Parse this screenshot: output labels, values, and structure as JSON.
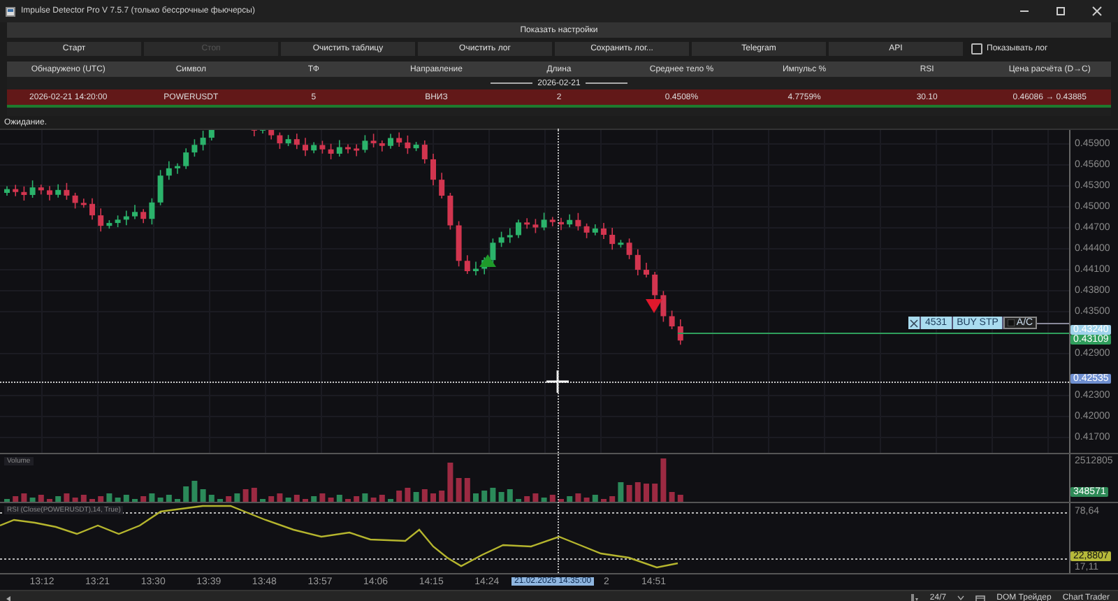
{
  "window": {
    "title": "Impulse Detector Pro V 7.5.7 (только бессрочные фьючерсы)"
  },
  "settings_button": "Показать настройки",
  "toolbar": {
    "buttons": [
      {
        "label": "Старт",
        "disabled": false
      },
      {
        "label": "Стоп",
        "disabled": true
      },
      {
        "label": "Очистить таблицу",
        "disabled": false
      },
      {
        "label": "Очистить лог",
        "disabled": false
      },
      {
        "label": "Сохранить лог...",
        "disabled": false
      },
      {
        "label": "Telegram",
        "disabled": false
      },
      {
        "label": "API",
        "disabled": false
      }
    ],
    "show_log": {
      "label": "Показывать лог",
      "checked": false
    }
  },
  "table": {
    "columns": [
      "Обнаружено (UTC)",
      "Символ",
      "ТФ",
      "Направление",
      "Длина",
      "Среднее тело %",
      "Импульс %",
      "RSI",
      "Цена расчёта (D→C)"
    ],
    "groups": [
      {
        "label": "2026-02-21",
        "rows": [
          {
            "cells": [
              "2026-02-21 14:20:00",
              "POWERUSDT",
              "5",
              "ВНИЗ",
              "2",
              "0.4508%",
              "4.7759%",
              "30.10",
              "0.46086 → 0.43885"
            ]
          }
        ]
      }
    ]
  },
  "status": "Ожидание.",
  "chart": {
    "price_axis": {
      "ticks": [
        "0.45900",
        "0.45600",
        "0.45300",
        "0.45000",
        "0.44700",
        "0.44400",
        "0.44100",
        "0.43800",
        "0.43500",
        "0.42900",
        "0.42300",
        "0.42000",
        "0.41700"
      ],
      "badges": [
        {
          "text": "0.43240",
          "color": "#9fd3ea"
        },
        {
          "text": "0.43109",
          "color": "#2f9e5c"
        },
        {
          "text": "0.42535",
          "color": "#6f8fd0"
        }
      ]
    },
    "order": {
      "quantity": "4531",
      "type": "BUY STP",
      "tag": "A/C"
    },
    "volume": {
      "title": "Volume",
      "axis_max": "2512805",
      "badge": "348571"
    },
    "rsi": {
      "title": "RSI (Close(POWERUSDT),14, True)",
      "upper": "78,64",
      "badge": "22,8807",
      "lower": "17,11"
    },
    "time_axis": [
      {
        "text": "13:12",
        "kind": "tick"
      },
      {
        "text": "13:21",
        "kind": "tick"
      },
      {
        "text": "13:30",
        "kind": "tick"
      },
      {
        "text": "13:39",
        "kind": "tick"
      },
      {
        "text": "13:48",
        "kind": "tick"
      },
      {
        "text": "13:57",
        "kind": "tick"
      },
      {
        "text": "14:06",
        "kind": "tick"
      },
      {
        "text": "14:15",
        "kind": "tick"
      },
      {
        "text": "14:24",
        "kind": "tick"
      },
      {
        "text": "21.02.2026 14:35:00",
        "kind": "cursor"
      },
      {
        "text": "2",
        "kind": "tick"
      },
      {
        "text": "14:51",
        "kind": "tick"
      }
    ]
  },
  "status_bar": {
    "session": "24/7",
    "buttons": [
      "DOM Трейдер",
      "Chart Trader"
    ]
  }
}
